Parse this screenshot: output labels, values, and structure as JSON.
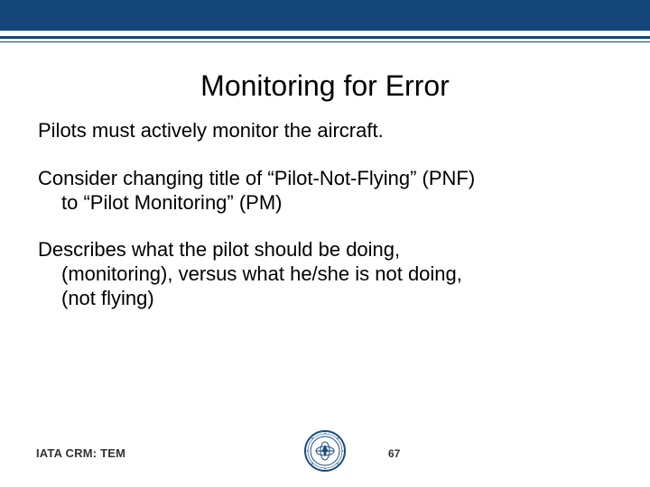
{
  "title": "Monitoring for Error",
  "para1": "Pilots must actively monitor the aircraft.",
  "para2_line1": "Consider changing title of “Pilot-Not-Flying” (PNF)",
  "para2_line2": "to “Pilot Monitoring” (PM)",
  "para3_line1": "Describes what the pilot should be doing,",
  "para3_line2": "(monitoring), versus what he/she is not doing,",
  "para3_line3": "(not flying)",
  "footer_label": "IATA CRM: TEM",
  "page_number": "67",
  "seal_name": "iata-seal"
}
